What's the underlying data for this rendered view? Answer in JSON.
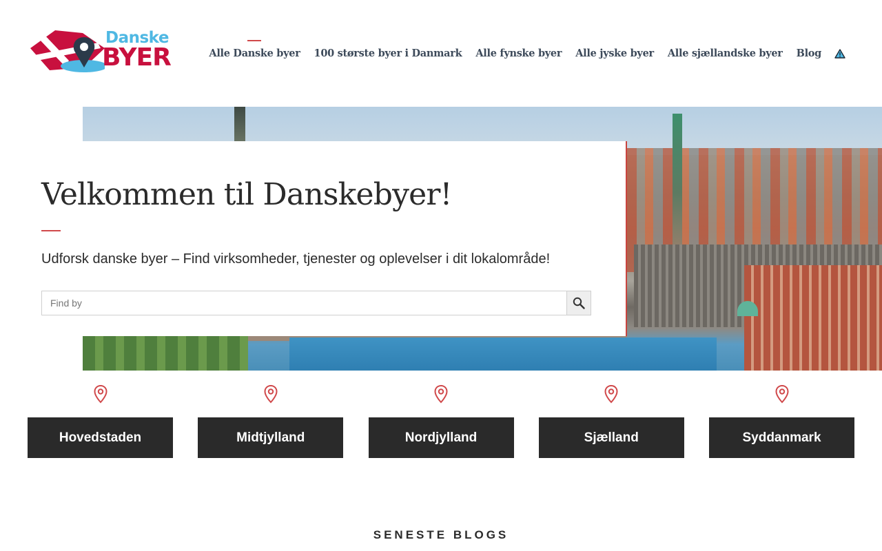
{
  "brand": {
    "logo_top": "Danske",
    "logo_bottom": "BYER",
    "colors": {
      "red": "#c8103e",
      "blue": "#4fb8e3",
      "accent": "#d0484a",
      "dark": "#2a2a2a"
    }
  },
  "nav": {
    "items": [
      {
        "label": "Alle Danske byer",
        "active": true
      },
      {
        "label": "100 største byer i Danmark"
      },
      {
        "label": "Alle fynske byer"
      },
      {
        "label": "Alle jyske byer"
      },
      {
        "label": "Alle sjællandske byer"
      },
      {
        "label": "Blog"
      }
    ],
    "icon": "warning-triangle-icon"
  },
  "hero": {
    "title": "Velkommen til Danskebyer!",
    "subtitle": "Udforsk danske byer – Find virksomheder, tjenester og oplevelser i dit lokalområde!",
    "search": {
      "placeholder": "Find by",
      "value": "",
      "button_icon": "search-icon"
    }
  },
  "regions": {
    "icon": "map-pin-icon",
    "items": [
      {
        "label": "Hovedstaden"
      },
      {
        "label": "Midtjylland"
      },
      {
        "label": "Nordjylland"
      },
      {
        "label": "Sjælland"
      },
      {
        "label": "Syddanmark"
      }
    ]
  },
  "blogs": {
    "section_title": "SENESTE BLOGS"
  }
}
